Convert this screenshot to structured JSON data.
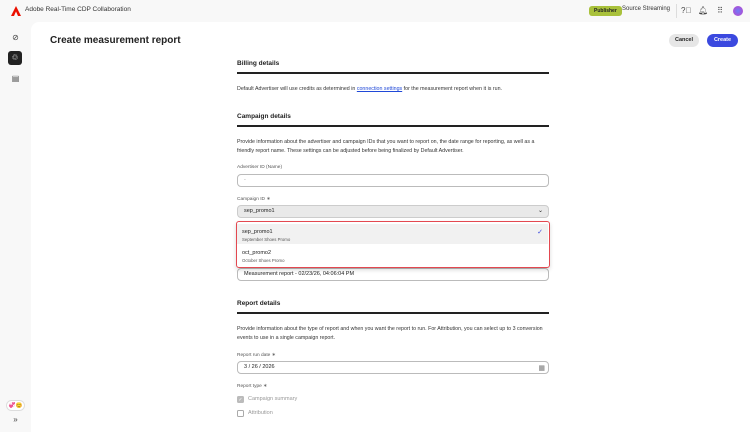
{
  "app": {
    "title": "Adobe Real-Time CDP Collaboration",
    "role_badge": "Publisher",
    "org": "Source Streaming"
  },
  "sidebar": {
    "icons": [
      "compass-icon",
      "collaboration-icon",
      "database-icon"
    ],
    "expand": "»",
    "feedback": "💞😊"
  },
  "page": {
    "title": "Create measurement report",
    "cancel": "Cancel",
    "create": "Create"
  },
  "billing": {
    "heading": "Billing details",
    "text_before": "Default Advertiser will use credits as determined in ",
    "link": "connection settings",
    "text_after": " for the measurement report when it is run."
  },
  "campaign": {
    "heading": "Campaign details",
    "description": "Provide information about the advertiser and campaign IDs that you want to report on, the date range for reporting, as well as a friendly report name. These settings can be adjusted before being finalized by Default Advertiser.",
    "advertiser_label": "Advertiser ID (Name)",
    "advertiser_value": "-",
    "campaign_label": "Campaign ID ∗",
    "campaign_value": "sep_promo1",
    "options": [
      {
        "name": "sep_promo1",
        "desc": "September Shoes Promo",
        "selected": true
      },
      {
        "name": "oct_promo2",
        "desc": "October Shoes Promo",
        "selected": false
      }
    ],
    "report_name_value": "Measurement report - 02/23/26, 04:06:04 PM"
  },
  "report": {
    "heading": "Report details",
    "description": "Provide information about the type of report and when you want the report to run. For Attribution, you can select up to 3 conversion events to use in a single campaign report.",
    "run_date_label": "Report run date ∗",
    "run_date_value": "3 / 26 / 2026",
    "type_label": "Report type ∗",
    "types": [
      {
        "label": "Campaign summary",
        "checked": true
      },
      {
        "label": "Attribution",
        "checked": false
      }
    ]
  }
}
